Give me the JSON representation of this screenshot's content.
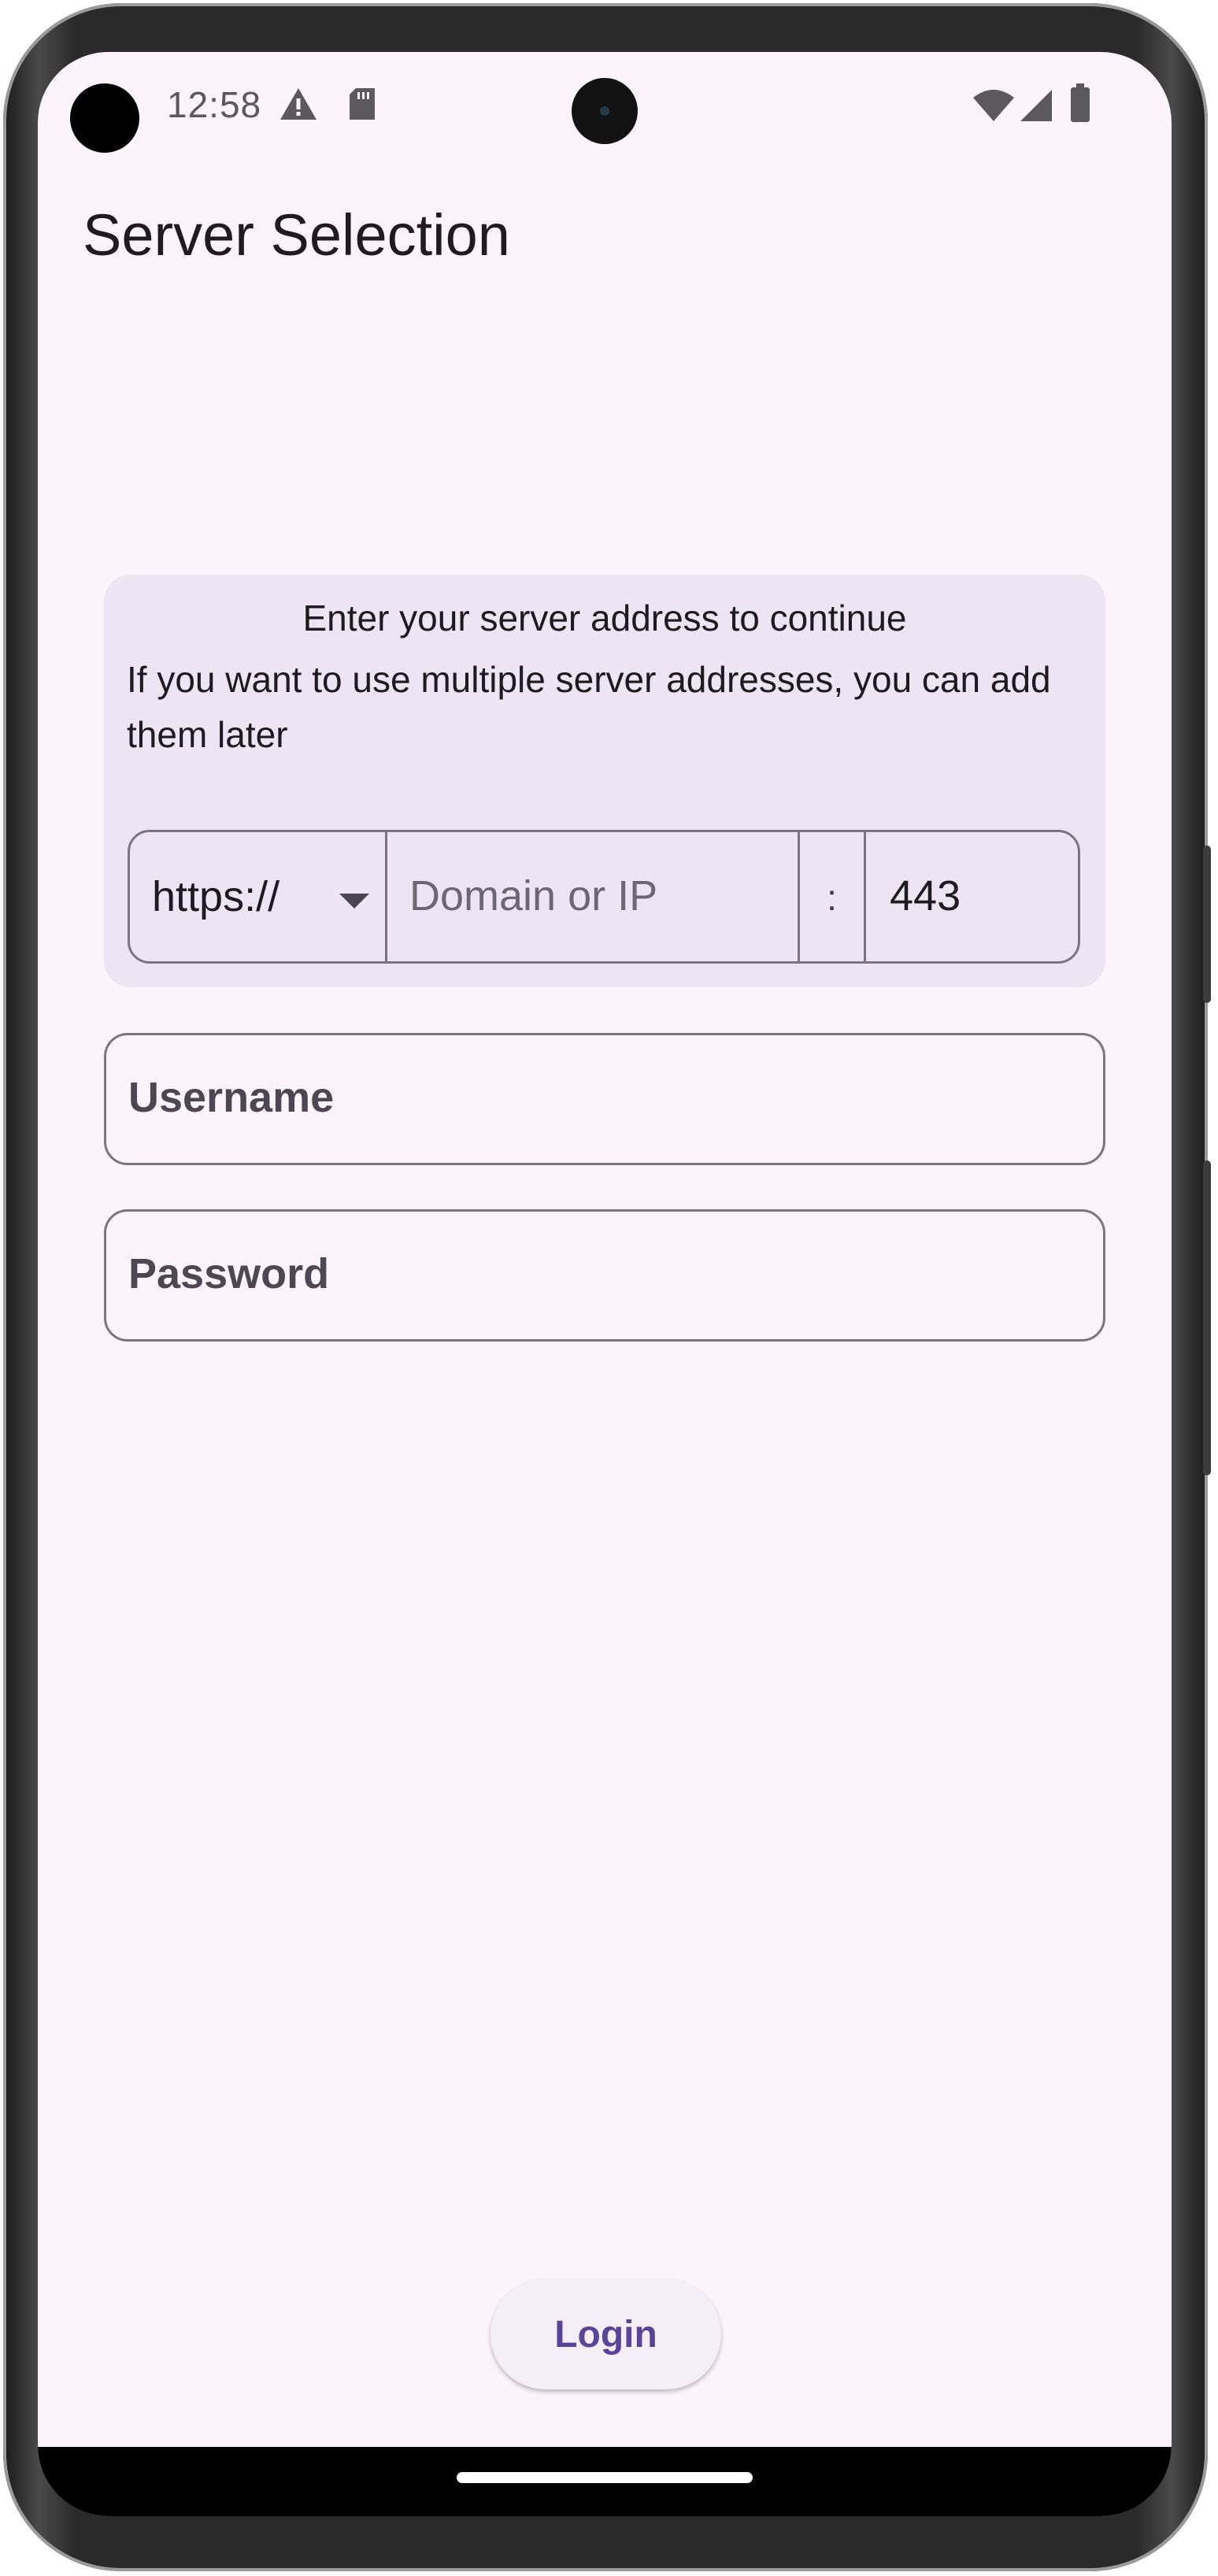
{
  "status_bar": {
    "time": "12:58",
    "icons": [
      "warning-icon",
      "sd-card-icon",
      "wifi-icon",
      "signal-icon",
      "battery-icon"
    ]
  },
  "header": {
    "title": "Server Selection"
  },
  "server_card": {
    "line1": "Enter your server address to continue",
    "line2": "If you want to use multiple server addresses, you can add them later",
    "protocol": "https://",
    "domain_placeholder": "Domain or IP",
    "separator": ":",
    "port": "443"
  },
  "form": {
    "username_placeholder": "Username",
    "password_placeholder": "Password"
  },
  "actions": {
    "login_label": "Login"
  },
  "colors": {
    "background": "#fbf4fb",
    "card": "#ede5f3",
    "accent": "#5a449a",
    "outline": "#7a767d"
  }
}
